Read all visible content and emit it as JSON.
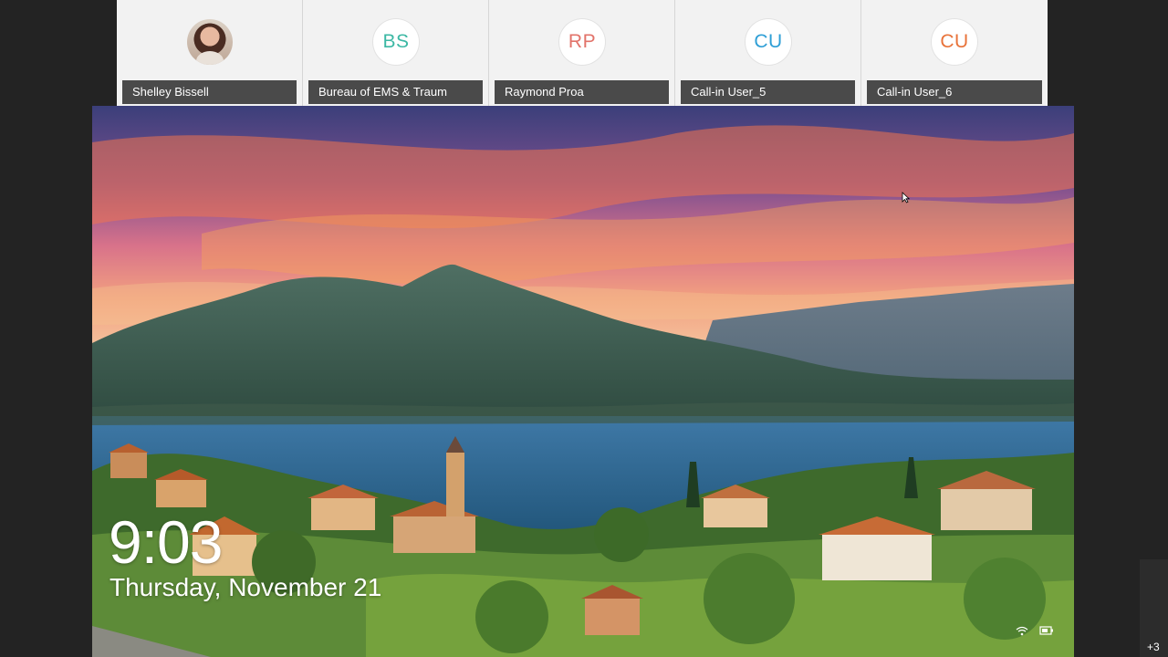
{
  "participants": [
    {
      "name": "Shelley Bissell",
      "initials": "",
      "initials_color": ""
    },
    {
      "name": "Bureau of EMS & Traum",
      "initials": "BS",
      "initials_color": "#3cb8a4"
    },
    {
      "name": "Raymond Proa",
      "initials": "RP",
      "initials_color": "#e2736a"
    },
    {
      "name": "Call-in User_5",
      "initials": "CU",
      "initials_color": "#2f9fd6"
    },
    {
      "name": "Call-in User_6",
      "initials": "CU",
      "initials_color": "#e8733a"
    }
  ],
  "lock_screen": {
    "time": "9:03",
    "date": "Thursday, November 21"
  },
  "overflow": {
    "label": "+3"
  },
  "icons": {
    "network": "wifi-icon",
    "battery": "battery-icon",
    "pointer": "mouse-cursor-icon"
  }
}
